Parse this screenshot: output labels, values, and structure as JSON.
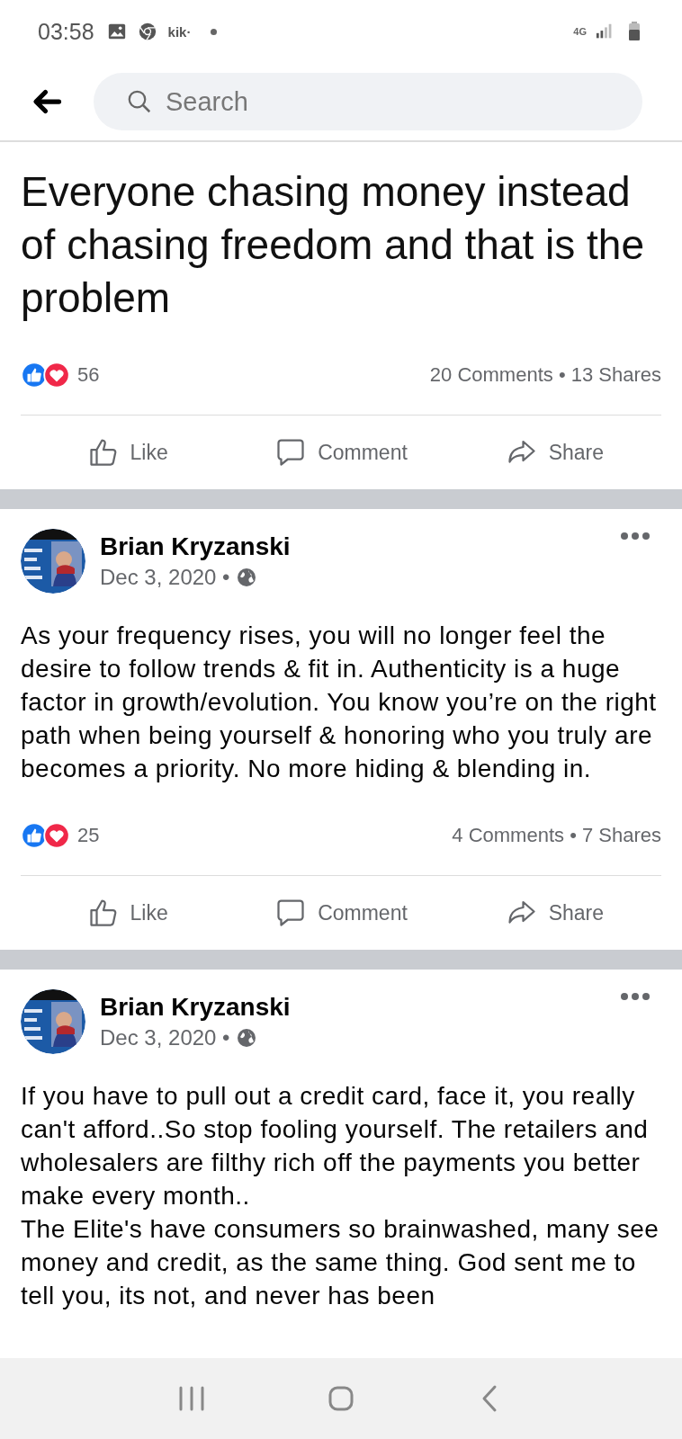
{
  "status_bar": {
    "time": "03:58",
    "app_label": "kik·",
    "network": "4G"
  },
  "search": {
    "placeholder": "Search"
  },
  "page_post": {
    "text": "Everyone chasing money instead of chasing freedom and that is the problem",
    "reactions": "56",
    "comments_shares": "20 Comments • 13 Shares",
    "actions": [
      {
        "kind": "like",
        "label": "Like"
      },
      {
        "kind": "comment",
        "label": "Comment"
      },
      {
        "kind": "share",
        "label": "Share"
      }
    ]
  },
  "posts": [
    {
      "author": "Brian Kryzanski",
      "date": "Dec 3, 2020 •",
      "paragraphs": [
        "As your frequency rises, you will no longer feel the desire to follow trends & fit in. Authenticity is a huge factor in growth/evolution. You know you’re on the right path when being yourself & honoring who you truly are becomes a priority. No more hiding & blending in."
      ],
      "reactions": "25",
      "comments_shares": "4 Comments • 7 Shares",
      "actions": [
        {
          "kind": "like",
          "label": "Like"
        },
        {
          "kind": "comment",
          "label": "Comment"
        },
        {
          "kind": "share",
          "label": "Share"
        }
      ]
    },
    {
      "author": "Brian Kryzanski",
      "date": "Dec 3, 2020 •",
      "paragraphs": [
        "If you have to pull out a credit card, face it, you really can't afford..So stop fooling yourself. The retailers and wholesalers are filthy rich off the payments you better make every month..",
        "The Elite's have consumers so brainwashed, many see money and credit, as the same thing. God sent me to tell you, its not, and never has been"
      ]
    }
  ]
}
